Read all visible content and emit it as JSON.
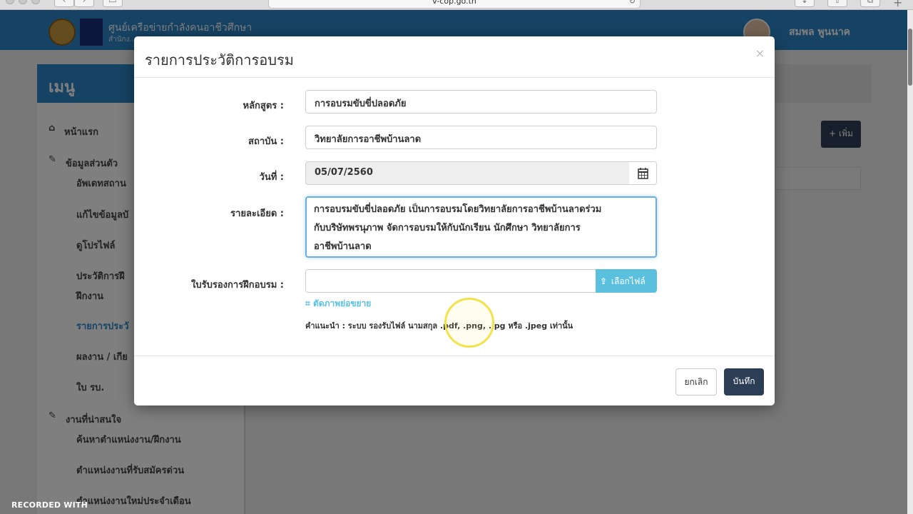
{
  "browser": {
    "url": "v-cop.go.th"
  },
  "site": {
    "title": "ศูนย์เครือข่ายกำลังคนอาชีวศึกษา",
    "subtitle": "สำนักง...",
    "user_name": "สมพล พูนนาค"
  },
  "sidebar": {
    "menu_title": "เมนู",
    "items": [
      {
        "label": "หน้าแรก",
        "icon": "home-icon"
      },
      {
        "label": "ข้อมูลส่วนตัว",
        "icon": "edit-icon"
      },
      {
        "label": "อัพเดทสถาน"
      },
      {
        "label": "แก้ไขข้อมูลบั"
      },
      {
        "label": "ดูโปรไฟล์"
      },
      {
        "label": "ประวัติการฝึ"
      },
      {
        "label": "ฝึกงาน"
      },
      {
        "label": "รายการประวั"
      },
      {
        "label": "ผลงาน / เกีย"
      },
      {
        "label": "ใบ รบ."
      },
      {
        "label": "งานที่น่าสนใจ",
        "icon": "edit-icon"
      },
      {
        "label": "ค้นหาตำแหน่งงาน/ฝึกงาน"
      },
      {
        "label": "ตำแหน่งงานที่รับสมัครด่วน"
      },
      {
        "label": "ตำแหน่งงานใหม่ประจำเดือน"
      }
    ]
  },
  "content": {
    "add_button": "+ เพิ่ม"
  },
  "modal": {
    "title": "รายการประวัติการอบรม",
    "close": "×",
    "course_label": "หลักสูตร :",
    "course_value": "การอบรมขับขี่ปลอดภัย",
    "institute_label": "สถาบัน :",
    "institute_value": "วิทยาลัยการอาชีพบ้านลาด",
    "date_label": "วันที่ :",
    "date_value": "05/07/2560",
    "detail_label": "รายละเอียด :",
    "detail_lines": [
      "การอบรมขับขี่ปลอดภัย เป็นการอบรมโดยวิทยาลัยการอาชีพบ้านลาดร่วม",
      "กับบริษัทพรนุภาพ จัดการอบรมให้กับนักเรียน นักศึกษา วิทยาลัยการ",
      "อาชีพบ้านลาด"
    ],
    "certificate_label": "ใบรับรองการฝึกอบรม :",
    "file_button": "เลือกไฟล์",
    "crop_link": "ตัดภาพย่อขยาย",
    "hint": "คำแนะนำ : ระบบ รองรับไฟล์ นามสกุล .pdf, .png, .jpg หรือ .jpeg เท่านั้น",
    "cancel_button": "ยกเลิก",
    "save_button": "บันทึก"
  },
  "recording": {
    "watermark": "RECORDED WITH"
  }
}
